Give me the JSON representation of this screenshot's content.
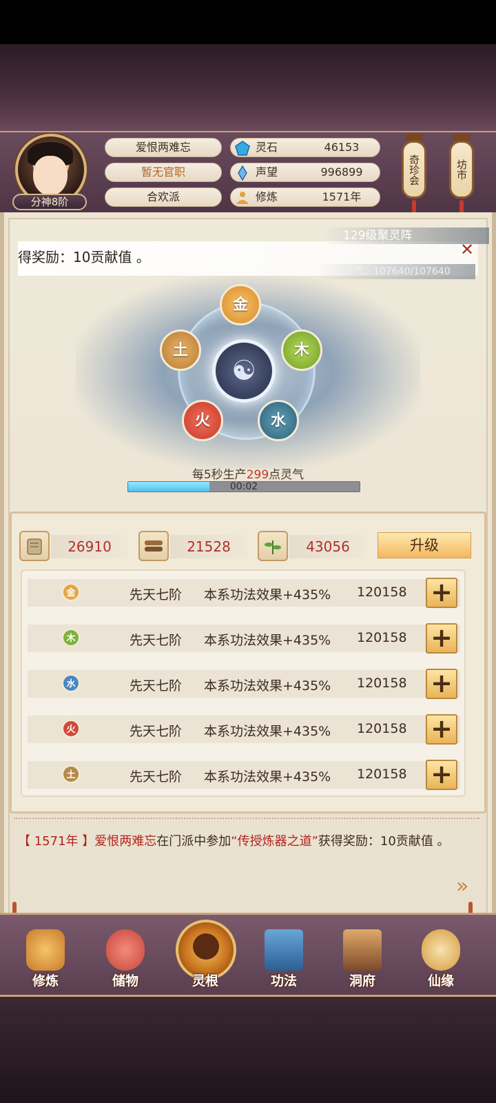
{
  "player": {
    "rank": "分神8阶",
    "name": "爱恨两难忘",
    "official_post": "暂无官职",
    "sect": "合欢派"
  },
  "resources": [
    {
      "label": "灵石",
      "value": "46153",
      "icon": "spirit-stone-icon"
    },
    {
      "label": "声望",
      "value": "996899",
      "icon": "prestige-crystal-icon"
    },
    {
      "label": "修炼",
      "value": "1571年",
      "icon": "meditation-icon"
    }
  ],
  "lanterns": {
    "qizhen": "奇珍会",
    "fangshi": "坊市"
  },
  "notification": {
    "reward": "得奖励：10贡献值 。",
    "close_icon": "close-icon"
  },
  "array": {
    "title": "129级聚灵阵",
    "qi": "灵气：107640/107640",
    "rate_prefix": "每5秒生产",
    "rate_value": "299",
    "rate_suffix": "点灵气",
    "timer": "00:02",
    "progress": 0.35,
    "elements": {
      "gold": "金",
      "wood": "木",
      "water": "水",
      "fire": "火",
      "earth": "土"
    },
    "center_icon": "yin-yang-icon"
  },
  "materials": [
    {
      "icon": "scroll-icon",
      "value": "26910"
    },
    {
      "icon": "wood-bundle-icon",
      "value": "21528"
    },
    {
      "icon": "herb-icon",
      "value": "43056"
    }
  ],
  "upgrade_label": "升级",
  "root_rows": [
    {
      "element": "金",
      "stage": "先天七阶",
      "effect": "本系功法效果+435%",
      "cost": "120158",
      "color": "#e3a548"
    },
    {
      "element": "木",
      "stage": "先天七阶",
      "effect": "本系功法效果+435%",
      "cost": "120158",
      "color": "#7fb23a"
    },
    {
      "element": "水",
      "stage": "先天七阶",
      "effect": "本系功法效果+435%",
      "cost": "120158",
      "color": "#4a87c0"
    },
    {
      "element": "火",
      "stage": "先天七阶",
      "effect": "本系功法效果+435%",
      "cost": "120158",
      "color": "#d2493a"
    },
    {
      "element": "土",
      "stage": "先天七阶",
      "effect": "本系功法效果+435%",
      "cost": "120158",
      "color": "#b58a4a"
    }
  ],
  "plus_label": "+",
  "log": {
    "year": "【 1571年 】",
    "name": "爱恨两难忘",
    "mid": "在门派中参加",
    "event": "“传授炼器之道”",
    "end": "获得奖励：10贡献值 。"
  },
  "nav": [
    {
      "label": "修炼",
      "icon": "cultivation-icon"
    },
    {
      "label": "储物",
      "icon": "storage-bag-icon"
    },
    {
      "label": "灵根",
      "icon": "spirit-root-icon"
    },
    {
      "label": "功法",
      "icon": "technique-book-icon"
    },
    {
      "label": "洞府",
      "icon": "cave-dwelling-icon"
    },
    {
      "label": "仙缘",
      "icon": "immortal-fate-icon"
    }
  ],
  "colors": {
    "accent_red": "#b3231b",
    "gold": "#e3a548",
    "panel": "#ece5d4"
  }
}
